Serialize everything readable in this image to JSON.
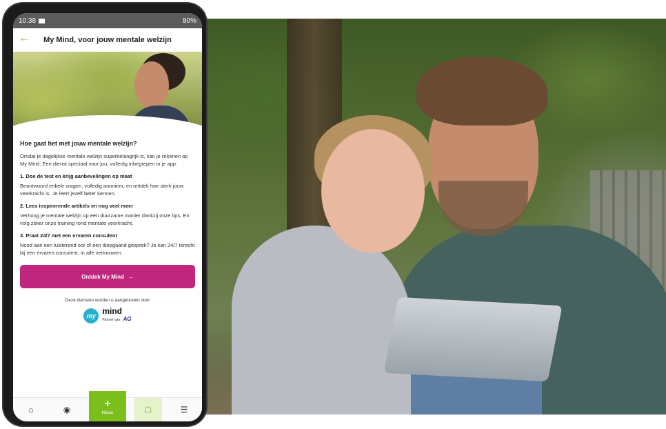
{
  "status": {
    "time": "10:38",
    "battery": "80%"
  },
  "appbar": {
    "title": "My Mind, voor jouw mentale welzijn"
  },
  "content": {
    "heading": "Hoe gaat het met jouw mentale welzijn?",
    "intro": "Omdat je dagelijkse mentale welzijn superbelangrijk is, kan je rekenen op My Mind. Een dienst speciaal voor jou, volledig inbegrepen in je app.",
    "sections": [
      {
        "title": "1. Doe de test en krijg aanbevelingen op maat",
        "text": "Beantwoord enkele vragen, volledig anoniem, en ontdek hoe sterk jouw veerkracht is. Je leert jezelf beter kennen."
      },
      {
        "title": "2. Lees inspirerende artikels en nog veel meer",
        "text": "Verhoog je mentale welzijn op een duurzame manier dankzij onze tips. En volg zeker onze training rond mentale veerkracht."
      },
      {
        "title": "3. Praat 24/7 met een ervaren consulent",
        "text": "Nood aan een luisterend oor of een diepgaand gesprek? Je kan 24/7 terecht bij een ervaren consulent, in alle vertrouwen."
      }
    ],
    "cta_label": "Ontdek My Mind",
    "provided_by": "Deze diensten worden u aangeboden door",
    "logo": {
      "mark": "my",
      "name": "mind",
      "partner": "Partner van",
      "partner_brand": "AG"
    }
  },
  "nav": {
    "new_label": "Nieuw"
  },
  "icons": [
    "back-arrow-icon",
    "image-icon",
    "home-icon",
    "profile-icon",
    "plus-icon",
    "tag-icon",
    "menu-icon",
    "arrow-right-icon"
  ],
  "colors": {
    "accent_green": "#7cbf1d",
    "cta_magenta": "#c0267e",
    "logo_teal": "#2ab0c9"
  }
}
